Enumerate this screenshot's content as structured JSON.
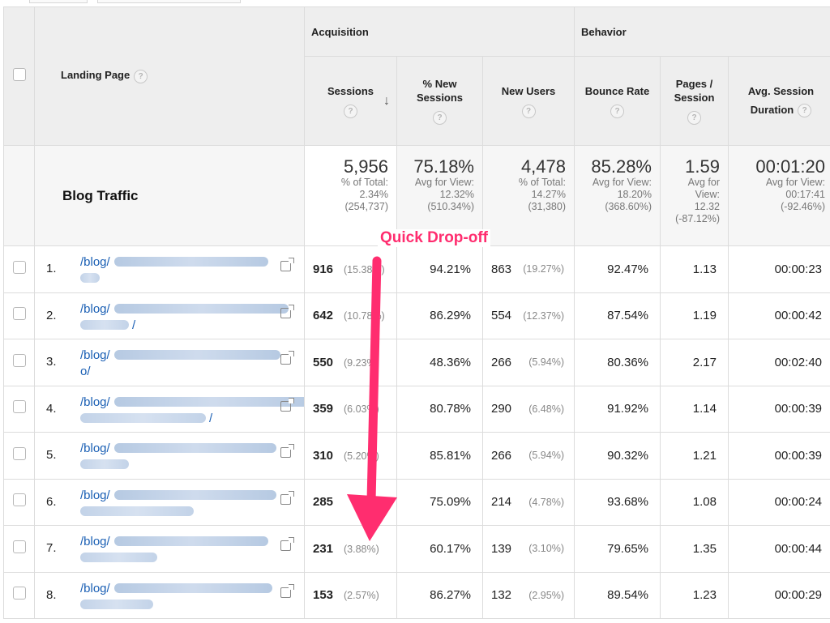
{
  "header": {
    "landing_page_label": "Landing Page",
    "groups": {
      "acquisition": "Acquisition",
      "behavior": "Behavior"
    },
    "columns": {
      "sessions": "Sessions",
      "pct_new_1": "% New",
      "pct_new_2": "Sessions",
      "new_users": "New Users",
      "bounce_rate": "Bounce Rate",
      "pages_1": "Pages /",
      "pages_2": "Session",
      "avg_1": "Avg. Session",
      "avg_2": "Duration"
    },
    "help_glyph": "?",
    "sort_glyph": "↓"
  },
  "summary": {
    "title": "Blog Traffic",
    "sessions": {
      "value": "5,956",
      "l1": "% of Total:",
      "l2": "2.34%",
      "l3": "(254,737)"
    },
    "pct_new": {
      "value": "75.18%",
      "l1": "Avg for View:",
      "l2": "12.32%",
      "l3": "(510.34%)"
    },
    "new_users": {
      "value": "4,478",
      "l1": "% of Total:",
      "l2": "14.27%",
      "l3": "(31,380)"
    },
    "bounce": {
      "value": "85.28%",
      "l1": "Avg for View:",
      "l2": "18.20%",
      "l3": "(368.60%)"
    },
    "pages": {
      "value": "1.59",
      "l1": "Avg for",
      "l2": "View:",
      "l3": "12.32",
      "l4": "(-87.12%)"
    },
    "duration": {
      "value": "00:01:20",
      "l1": "Avg for View:",
      "l2": "00:17:41",
      "l3": "(-92.46%)"
    }
  },
  "annotation": {
    "text": "Quick Drop-off",
    "color": "#ff2d6f"
  },
  "rows": [
    {
      "rank": "1.",
      "path": "/blog/",
      "frag": "",
      "sessions": "916",
      "sessions_pct": "(15.38%)",
      "pct_new": "94.21%",
      "new_users": "863",
      "new_users_pct": "(19.27%)",
      "bounce": "92.47%",
      "pages": "1.13",
      "duration": "00:00:23"
    },
    {
      "rank": "2.",
      "path": "/blog/",
      "frag": "/",
      "sessions": "642",
      "sessions_pct": "(10.78%)",
      "pct_new": "86.29%",
      "new_users": "554",
      "new_users_pct": "(12.37%)",
      "bounce": "87.54%",
      "pages": "1.19",
      "duration": "00:00:42"
    },
    {
      "rank": "3.",
      "path": "/blog/",
      "frag": "o/",
      "sessions": "550",
      "sessions_pct": "(9.23%)",
      "pct_new": "48.36%",
      "new_users": "266",
      "new_users_pct": "(5.94%)",
      "bounce": "80.36%",
      "pages": "2.17",
      "duration": "00:02:40"
    },
    {
      "rank": "4.",
      "path": "/blog/",
      "frag": "/",
      "sessions": "359",
      "sessions_pct": "(6.03%)",
      "pct_new": "80.78%",
      "new_users": "290",
      "new_users_pct": "(6.48%)",
      "bounce": "91.92%",
      "pages": "1.14",
      "duration": "00:00:39"
    },
    {
      "rank": "5.",
      "path": "/blog/",
      "frag": "",
      "sessions": "310",
      "sessions_pct": "(5.20%)",
      "pct_new": "85.81%",
      "new_users": "266",
      "new_users_pct": "(5.94%)",
      "bounce": "90.32%",
      "pages": "1.21",
      "duration": "00:00:39"
    },
    {
      "rank": "6.",
      "path": "/blog/",
      "frag": "",
      "sessions": "285",
      "sessions_pct": "",
      "pct_new": "75.09%",
      "new_users": "214",
      "new_users_pct": "(4.78%)",
      "bounce": "93.68%",
      "pages": "1.08",
      "duration": "00:00:24"
    },
    {
      "rank": "7.",
      "path": "/blog/",
      "frag": "",
      "sessions": "231",
      "sessions_pct": "(3.88%)",
      "pct_new": "60.17%",
      "new_users": "139",
      "new_users_pct": "(3.10%)",
      "bounce": "79.65%",
      "pages": "1.35",
      "duration": "00:00:44"
    },
    {
      "rank": "8.",
      "path": "/blog/",
      "frag": "",
      "sessions": "153",
      "sessions_pct": "(2.57%)",
      "pct_new": "86.27%",
      "new_users": "132",
      "new_users_pct": "(2.95%)",
      "bounce": "89.54%",
      "pages": "1.23",
      "duration": "00:00:29"
    }
  ]
}
